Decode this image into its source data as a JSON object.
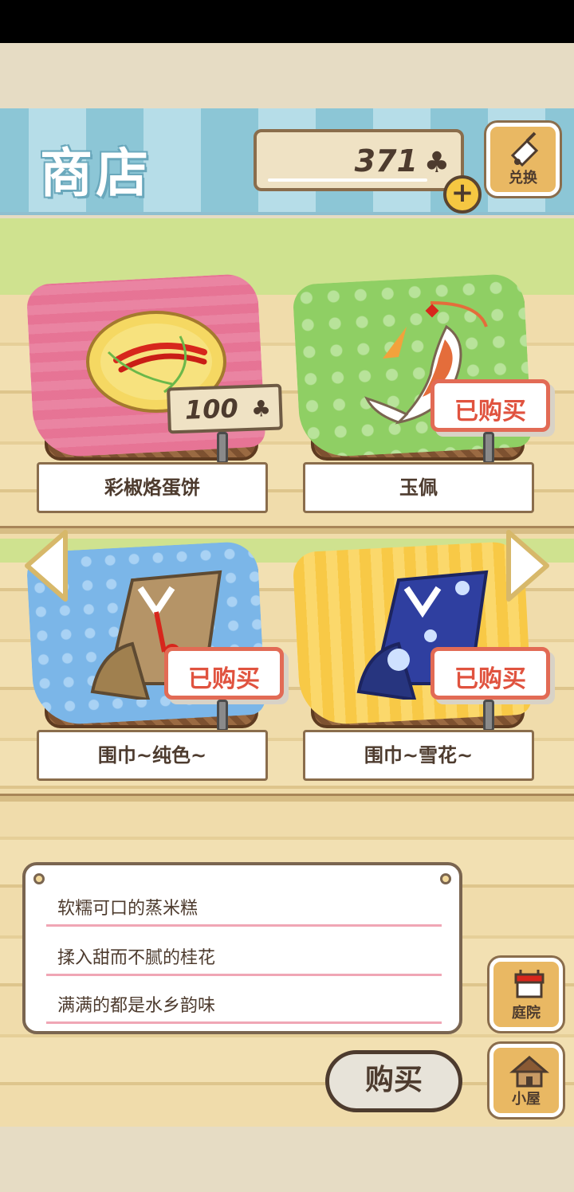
{
  "header": {
    "title": "商店",
    "currency_value": "371",
    "currency_icon": "clover-icon",
    "plus_label": "+",
    "exchange_label": "兑换"
  },
  "items": [
    {
      "name": "彩椒烙蛋饼",
      "price": "100",
      "status": "",
      "cloth": "pink"
    },
    {
      "name": "玉佩",
      "price": "",
      "status": "已购买",
      "cloth": "green"
    },
    {
      "name": "围巾~纯色~",
      "price": "",
      "status": "已购买",
      "cloth": "blue"
    },
    {
      "name": "围巾~雪花~",
      "price": "",
      "status": "已购买",
      "cloth": "yellow"
    }
  ],
  "description": {
    "lines": [
      "软糯可口的蒸米糕",
      "揉入甜而不腻的桂花",
      "满满的都是水乡韵味"
    ]
  },
  "buy_label": "购买",
  "side_buttons": {
    "yard_label": "庭院",
    "house_label": "小屋"
  },
  "colors": {
    "accent_red": "#e0533f",
    "header_blue": "#8cc6d6",
    "wood": "#f0dcab",
    "grass": "#cfe28f"
  }
}
